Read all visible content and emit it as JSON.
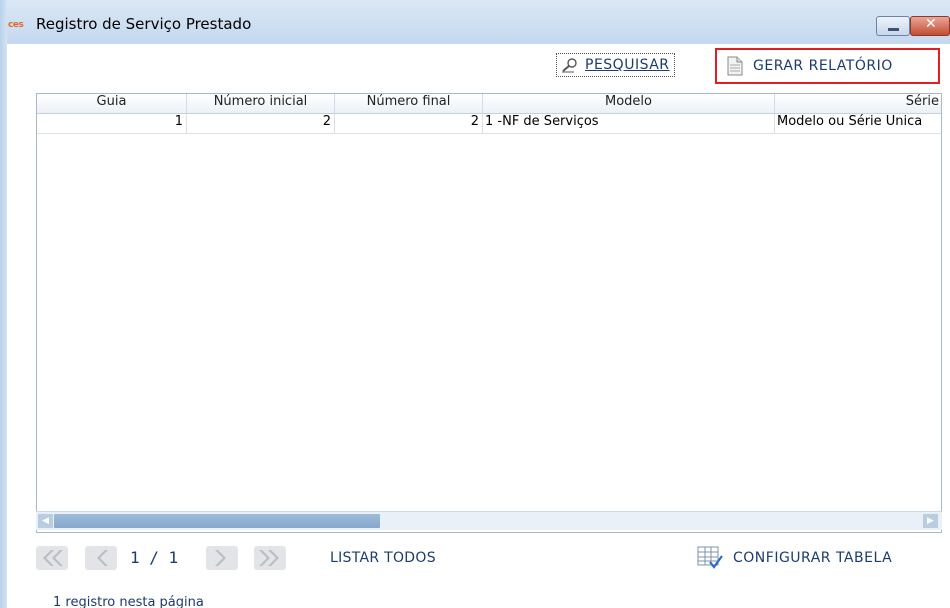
{
  "window": {
    "title": "Registro de Serviço Prestado",
    "app_icon_text": "ces",
    "close_glyph": "✕"
  },
  "toolbar": {
    "pesquisar_label": "PESQUISAR",
    "gerar_label": "GERAR RELATÓRIO"
  },
  "table": {
    "columns": [
      "Guia",
      "Número inicial",
      "Número final",
      "Modelo",
      "Série"
    ],
    "rows": [
      [
        "1",
        "2",
        "2",
        "1 -NF de Serviços",
        "Modelo ou Série Única"
      ]
    ]
  },
  "pager": {
    "page_text": "1 / 1",
    "listar_label": "LISTAR TODOS",
    "config_label": "CONFIGURAR TABELA",
    "status_text": "1 registro nesta página"
  },
  "colors": {
    "accent_text": "#1b3c6e",
    "highlight_border": "#e01e26",
    "disabled_nav": "#c9ced6"
  }
}
